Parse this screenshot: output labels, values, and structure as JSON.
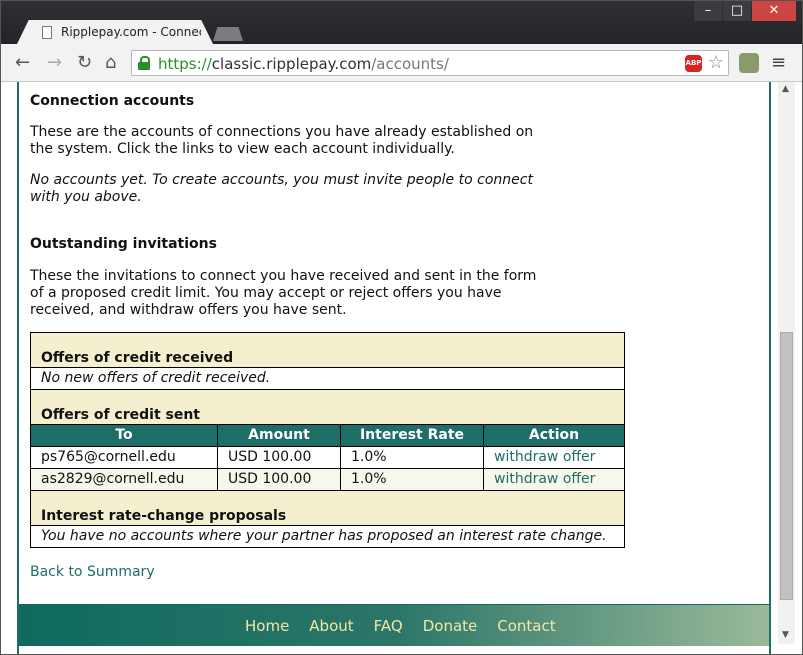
{
  "browser": {
    "tab_title": "Ripplepay.com - Connec",
    "url_scheme": "https://",
    "url_host": "classic.ripplepay.com",
    "url_path": "/accounts/",
    "abp_label": "ABP"
  },
  "connection": {
    "heading": "Connection accounts",
    "description": "These are the accounts of connections you have already established on the system. Click the links to view each account individually.",
    "empty": "No accounts yet. To create accounts, you must invite people to connect with you above."
  },
  "invitations": {
    "heading": "Outstanding invitations",
    "description": "These the invitations to connect you have received and sent in the form of a proposed credit limit. You may accept or reject offers you have received, and withdraw offers you have sent."
  },
  "offers_received": {
    "heading": "Offers of credit received",
    "empty": "No new offers of credit received."
  },
  "offers_sent": {
    "heading": "Offers of credit sent",
    "columns": [
      "To",
      "Amount",
      "Interest Rate",
      "Action"
    ],
    "rows": [
      {
        "to": "ps765@cornell.edu",
        "amount": "USD 100.00",
        "rate": "1.0%",
        "action": "withdraw offer"
      },
      {
        "to": "as2829@cornell.edu",
        "amount": "USD 100.00",
        "rate": "1.0%",
        "action": "withdraw offer"
      }
    ]
  },
  "rate_changes": {
    "heading": "Interest rate-change proposals",
    "empty": "You have no accounts where your partner has proposed an interest rate change."
  },
  "back_link": "Back to Summary",
  "footer": {
    "links": [
      "Home",
      "About",
      "FAQ",
      "Donate",
      "Contact"
    ]
  },
  "colors": {
    "accent": "#1d6e66",
    "section_bg": "#f4f0cf",
    "footer_link": "#f4e6a6"
  }
}
